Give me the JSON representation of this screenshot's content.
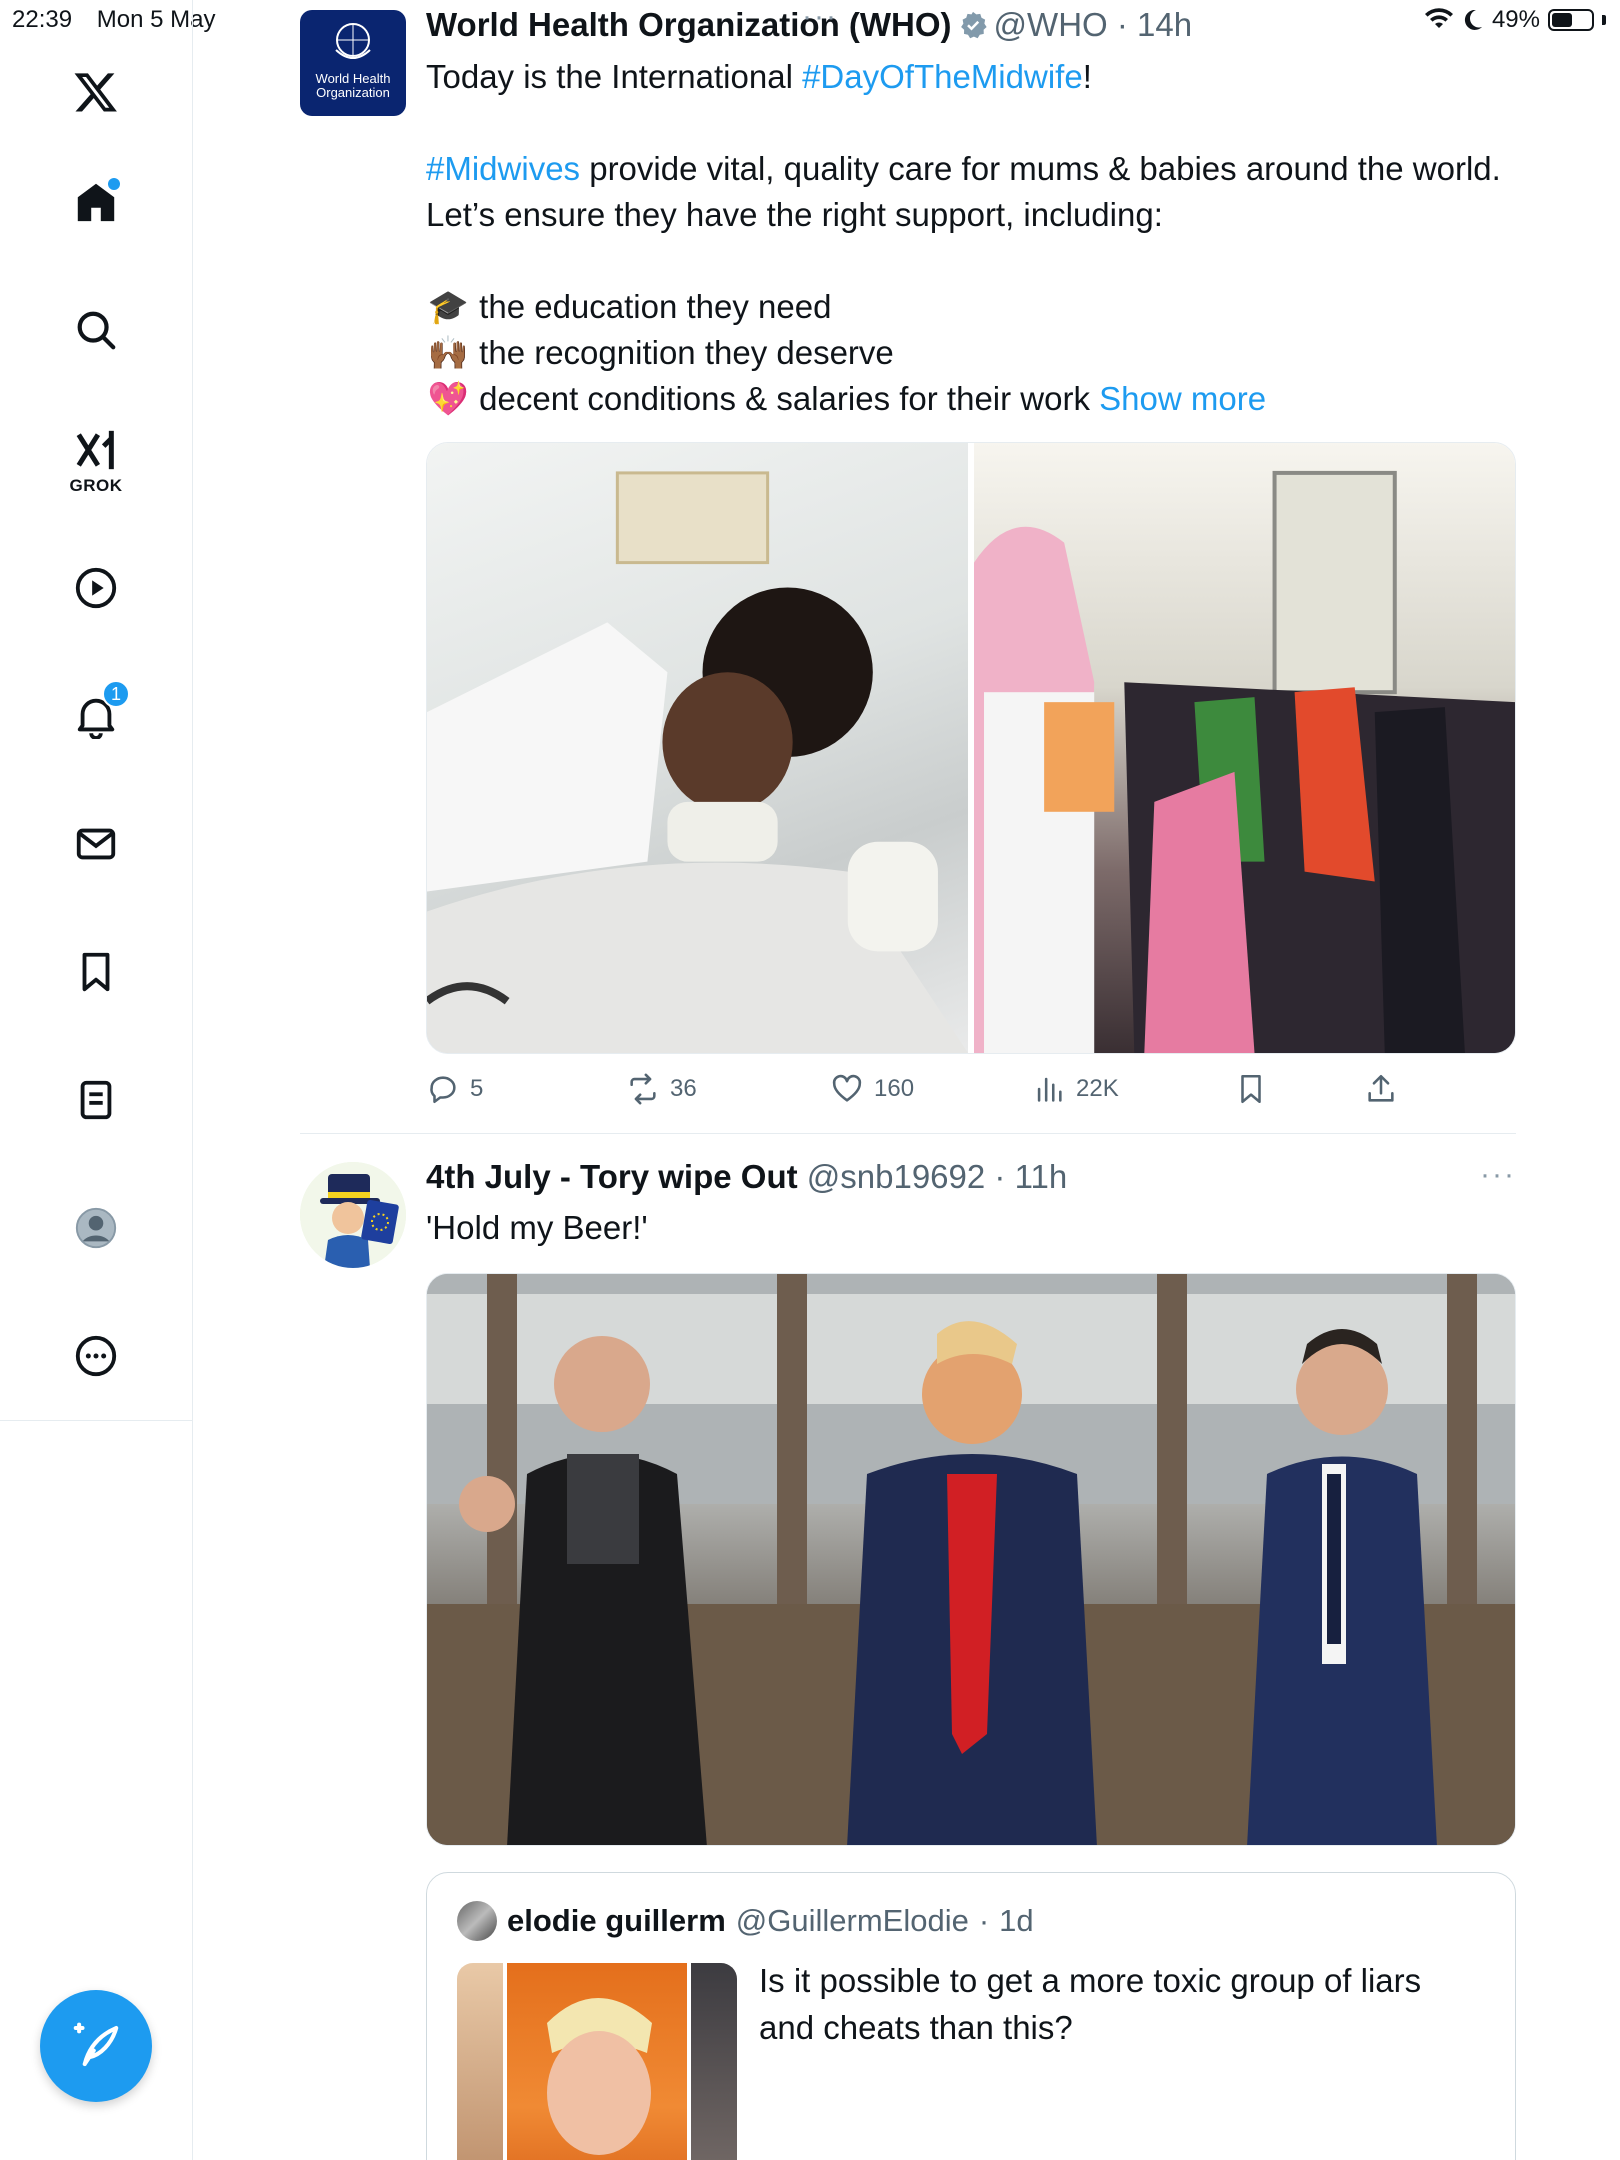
{
  "status_bar": {
    "time": "22:39",
    "date": "Mon 5 May",
    "battery": "49%",
    "battery_level": 0.49
  },
  "sidebar": {
    "items": [
      {
        "id": "logo",
        "icon": "x-logo-icon"
      },
      {
        "id": "home",
        "icon": "home-icon",
        "has_dot": true
      },
      {
        "id": "search",
        "icon": "search-icon"
      },
      {
        "id": "grok",
        "icon": "grok-icon",
        "label": "GROK"
      },
      {
        "id": "videos",
        "icon": "play-icon"
      },
      {
        "id": "notifications",
        "icon": "bell-icon",
        "badge": "1"
      },
      {
        "id": "messages",
        "icon": "envelope-icon"
      },
      {
        "id": "bookmarks",
        "icon": "bookmark-icon"
      },
      {
        "id": "lists",
        "icon": "lists-icon"
      },
      {
        "id": "profile",
        "icon": "profile-icon"
      },
      {
        "id": "more",
        "icon": "more-circle-icon"
      }
    ],
    "compose_icon": "compose-feather-icon"
  },
  "tweets": [
    {
      "author_name": "World Health Organization (WHO)",
      "handle": "@WHO",
      "time": "14h",
      "verified": true,
      "avatar_text": "World Health Organization",
      "text": {
        "line1_prefix": "Today is the International ",
        "line1_link": "#DayOfTheMidwife",
        "line1_suffix": "!",
        "line2_link": "#Midwives",
        "line2_rest": " provide vital, quality care for mums & babies around the world. Let’s ensure they have the right support, including:",
        "bullet1_emoji": "🎓",
        "bullet1": "the education they need",
        "bullet2_emoji": "🙌🏾",
        "bullet2": "the recognition they deserve",
        "bullet3_emoji": "💖",
        "bullet3": "decent conditions & salaries for their work",
        "show_more": "Show more"
      },
      "metrics": {
        "replies": "5",
        "reposts": "36",
        "likes": "160",
        "views": "22K"
      }
    },
    {
      "author_name": "4th July - Tory wipe Out",
      "handle": "@snb19692",
      "time": "11h",
      "text": "'Hold my Beer!'",
      "quote": {
        "author_name": "elodie guillerm",
        "handle": "@GuillermElodie",
        "time": "1d",
        "text": "Is it possible to get a more toxic group of liars and cheats than this?"
      }
    }
  ],
  "colors": {
    "accent": "#1d9bf0",
    "text": "#0f1419",
    "secondary": "#536471",
    "border": "#e6ecf0"
  }
}
